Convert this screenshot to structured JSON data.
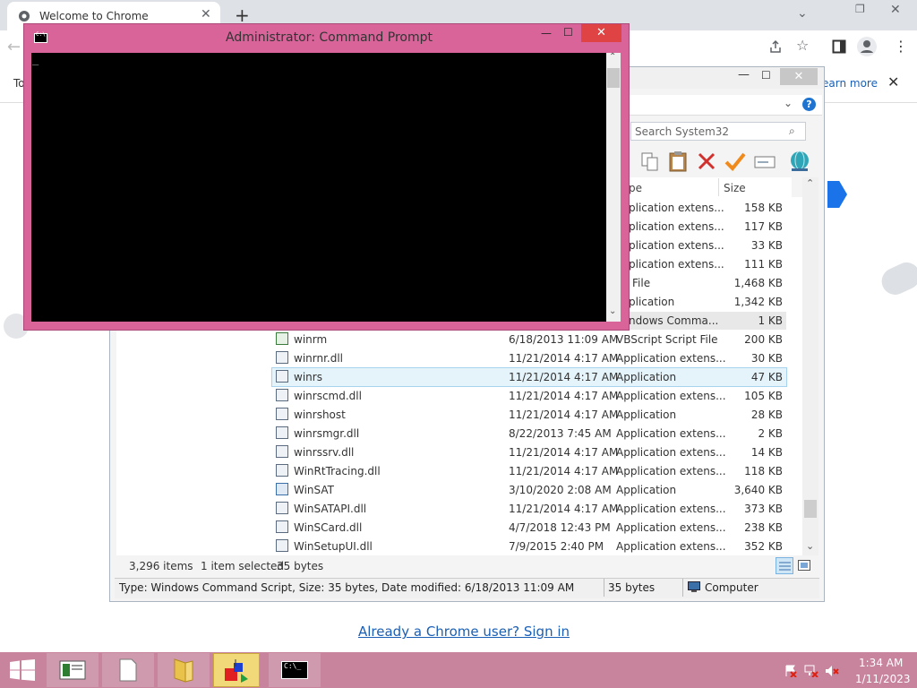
{
  "chrome": {
    "tab_title": "Welcome to Chrome",
    "infobar_left": "To",
    "infobar_learn": "earn more",
    "signin_link": "Already a Chrome user? Sign in"
  },
  "explorer": {
    "search_placeholder": "Search System32",
    "columns": {
      "type_partial": "pe",
      "size": "Size"
    },
    "partial_rows": [
      {
        "type": "plication extens...",
        "size": "158 KB"
      },
      {
        "type": "plication extens...",
        "size": "117 KB"
      },
      {
        "type": "plication extens...",
        "size": "33 KB"
      },
      {
        "type": "plication extens...",
        "size": "111 KB"
      },
      {
        "type": "File",
        "size": "1,468 KB"
      },
      {
        "type": "plication",
        "size": "1,342 KB"
      },
      {
        "type": "ndows Comma...",
        "size": "1 KB"
      }
    ],
    "rows": [
      {
        "name": "winrm",
        "date": "6/18/2013 11:09 AM",
        "type": "VBScript Script File",
        "size": "200 KB"
      },
      {
        "name": "winrnr.dll",
        "date": "11/21/2014 4:17 AM",
        "type": "Application extens...",
        "size": "30 KB"
      },
      {
        "name": "winrs",
        "date": "11/21/2014 4:17 AM",
        "type": "Application",
        "size": "47 KB"
      },
      {
        "name": "winrscmd.dll",
        "date": "11/21/2014 4:17 AM",
        "type": "Application extens...",
        "size": "105 KB"
      },
      {
        "name": "winrshost",
        "date": "11/21/2014 4:17 AM",
        "type": "Application",
        "size": "28 KB"
      },
      {
        "name": "winrsmgr.dll",
        "date": "8/22/2013 7:45 AM",
        "type": "Application extens...",
        "size": "2 KB"
      },
      {
        "name": "winrssrv.dll",
        "date": "11/21/2014 4:17 AM",
        "type": "Application extens...",
        "size": "14 KB"
      },
      {
        "name": "WinRtTracing.dll",
        "date": "11/21/2014 4:17 AM",
        "type": "Application extens...",
        "size": "118 KB"
      },
      {
        "name": "WinSAT",
        "date": "3/10/2020 2:08 AM",
        "type": "Application",
        "size": "3,640 KB"
      },
      {
        "name": "WinSATAPI.dll",
        "date": "11/21/2014 4:17 AM",
        "type": "Application extens...",
        "size": "373 KB"
      },
      {
        "name": "WinSCard.dll",
        "date": "4/7/2018 12:43 PM",
        "type": "Application extens...",
        "size": "238 KB"
      },
      {
        "name": "WinSetupUI.dll",
        "date": "7/9/2015 2:40 PM",
        "type": "Application extens...",
        "size": "352 KB"
      }
    ],
    "status_items": "3,296 items",
    "status_selected": "1 item selected",
    "status_bytes": "35 bytes",
    "details_text": "Type: Windows Command Script, Size: 35 bytes, Date modified: 6/18/2013 11:09 AM",
    "details_bytes": "35 bytes",
    "details_computer": "Computer"
  },
  "cmd": {
    "title": "Administrator:  Command Prompt",
    "cursor": "_"
  },
  "taskbar": {
    "time": "1:34 AM",
    "date": "1/11/2023"
  },
  "colors": {
    "cmd_frame": "#d9649a",
    "taskbar": "#c8839d",
    "link": "#1a5fb4",
    "close_red": "#e04343"
  }
}
